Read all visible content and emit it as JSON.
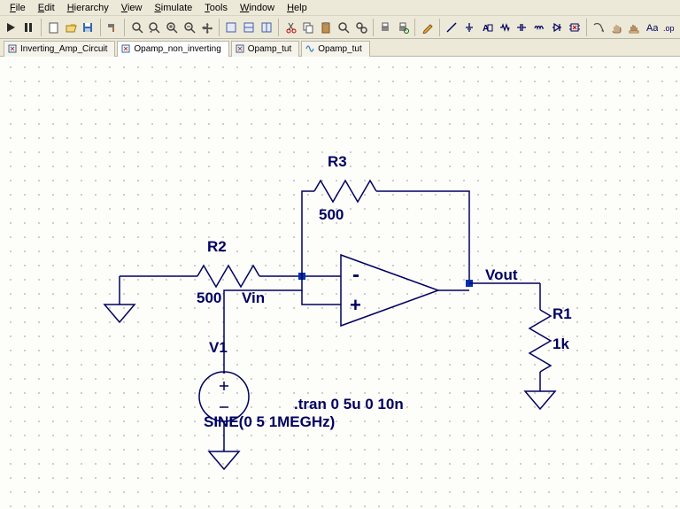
{
  "menu": {
    "file": "File",
    "edit": "Edit",
    "hierarchy": "Hierarchy",
    "view": "View",
    "simulate": "Simulate",
    "tools": "Tools",
    "window": "Window",
    "help": "Help"
  },
  "toolbar_icons": [
    "run",
    "pause",
    "stop",
    "new",
    "open",
    "save",
    "zoom-window",
    "zoom-extents",
    "zoom-back",
    "zoom-in",
    "zoom-out",
    "pan",
    "rotate",
    "autowire",
    "tile1",
    "tile2",
    "tile3",
    "cut",
    "copy",
    "paste",
    "find",
    "find-next",
    "print",
    "print-setup",
    "pencil",
    "wire",
    "ground",
    "label",
    "resistor",
    "capacitor",
    "inductor",
    "diode",
    "component",
    "move",
    "hand",
    "drag",
    "mirror"
  ],
  "tabs": [
    {
      "label": "Inverting_Amp_Circuit",
      "icon": "schematic",
      "active": false
    },
    {
      "label": "Opamp_non_inverting",
      "icon": "schematic",
      "active": true
    },
    {
      "label": "Opamp_tut",
      "icon": "schematic",
      "active": false
    },
    {
      "label": "Opamp_tut",
      "icon": "waveform",
      "active": false
    }
  ],
  "schematic": {
    "labels": {
      "r3_name": "R3",
      "r3_val": "500",
      "r2_name": "R2",
      "r2_val": "500",
      "r1_name": "R1",
      "r1_val": "1k",
      "v1_name": "V1",
      "vin": "Vin",
      "vout": "Vout",
      "tran": ".tran 0 5u 0 10n",
      "sine": "SINE(0 5 1MEGHz)"
    }
  }
}
